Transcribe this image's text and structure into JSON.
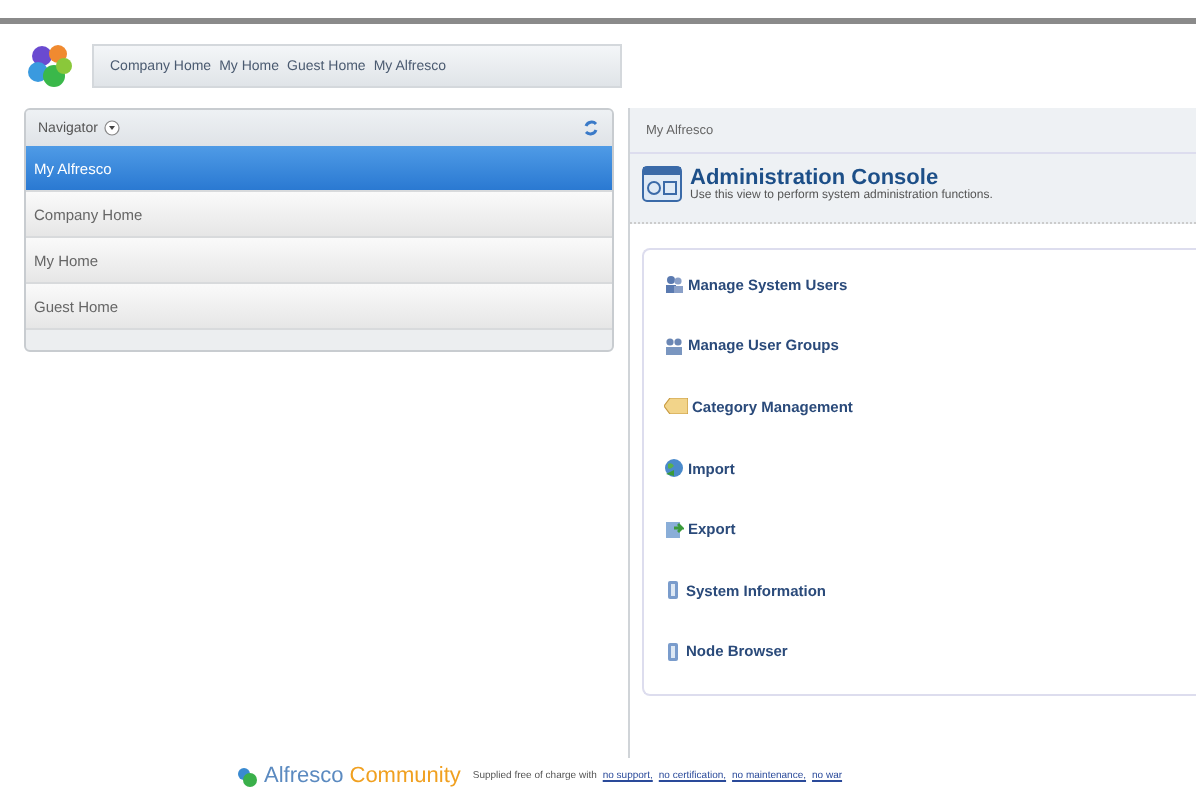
{
  "breadcrumbs": [
    "Company Home",
    "My Home",
    "Guest Home",
    "My Alfresco"
  ],
  "navigator": {
    "title": "Navigator",
    "items": [
      {
        "label": "My Alfresco",
        "selected": true
      },
      {
        "label": "Company Home",
        "selected": false
      },
      {
        "label": "My Home",
        "selected": false
      },
      {
        "label": "Guest Home",
        "selected": false
      }
    ]
  },
  "main": {
    "header": "My Alfresco",
    "title": "Administration Console",
    "subtitle": "Use this view to perform system administration functions.",
    "actions": [
      {
        "label": "Manage System Users",
        "kind": "users"
      },
      {
        "label": "Manage User Groups",
        "kind": "groups"
      },
      {
        "label": "Category Management",
        "kind": "category"
      },
      {
        "label": "Import",
        "kind": "import"
      },
      {
        "label": "Export",
        "kind": "export"
      },
      {
        "label": "System Information",
        "kind": "info"
      },
      {
        "label": "Node Browser",
        "kind": "info"
      }
    ]
  },
  "footer": {
    "brand_1": "Alfresco",
    "brand_2": "Community",
    "text": "Supplied free of charge with",
    "links": [
      "no support,",
      "no certification,",
      "no maintenance,",
      "no war"
    ]
  }
}
